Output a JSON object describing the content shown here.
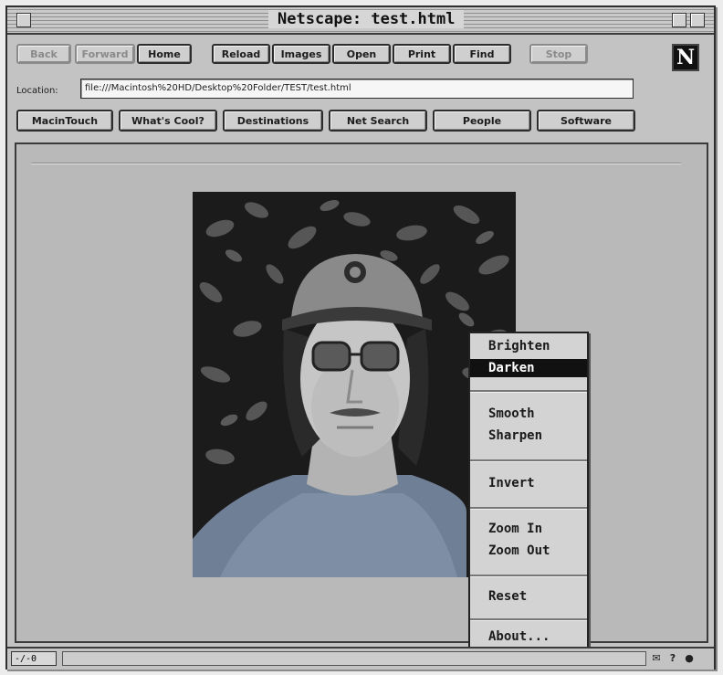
{
  "window": {
    "title": "Netscape: test.html"
  },
  "toolbar": {
    "back": "Back",
    "forward": "Forward",
    "home": "Home",
    "reload": "Reload",
    "images": "Images",
    "open": "Open",
    "print": "Print",
    "find": "Find",
    "stop": "Stop"
  },
  "logo": {
    "letter": "N"
  },
  "location": {
    "label": "Location:",
    "url": "file:///Macintosh%20HD/Desktop%20Folder/TEST/test.html"
  },
  "directory": {
    "macintosh": "MacinTouch",
    "whats_cool": "What's Cool?",
    "destinations": "Destinations",
    "net_search": "Net Search",
    "people": "People",
    "software": "Software"
  },
  "context_menu": {
    "brighten": "Brighten",
    "darken": "Darken",
    "smooth": "Smooth",
    "sharpen": "Sharpen",
    "invert": "Invert",
    "zoom_in": "Zoom In",
    "zoom_out": "Zoom Out",
    "reset": "Reset",
    "about": "About..."
  },
  "status": {
    "left": "-/-0"
  },
  "icons": {
    "close": "close-box-icon",
    "zoom": "zoom-box-icon",
    "collapse": "collapse-box-icon",
    "mail": "mail-icon",
    "help": "help-icon",
    "security": "security-icon"
  }
}
